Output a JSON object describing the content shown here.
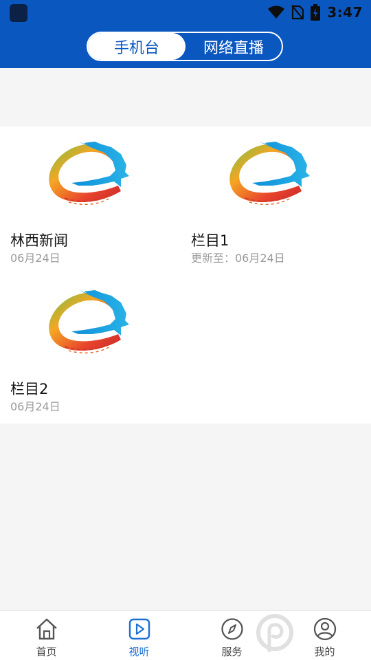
{
  "status_bar": {
    "time": "3:47",
    "icons": [
      "app-icon",
      "wifi-icon",
      "no-sim-icon",
      "battery-charging-icon"
    ]
  },
  "header": {
    "segments": [
      {
        "label": "手机台",
        "active": true
      },
      {
        "label": "网络直播",
        "active": false
      }
    ]
  },
  "cards": [
    {
      "title": "林西新闻",
      "date": "06月24日",
      "icon": "station-logo-icon"
    },
    {
      "title": "栏目1",
      "date": "更新至：06月24日",
      "icon": "station-logo-icon"
    },
    {
      "title": "栏目2",
      "date": "06月24日",
      "icon": "station-logo-icon"
    }
  ],
  "tabbar": {
    "items": [
      {
        "label": "首页",
        "icon": "home-icon",
        "active": false
      },
      {
        "label": "视听",
        "icon": "play-icon",
        "active": true
      },
      {
        "label": "服务",
        "icon": "compass-icon",
        "active": false
      },
      {
        "label": "我的",
        "icon": "user-icon",
        "active": false
      }
    ]
  },
  "colors": {
    "header_blue": "#0a57c0",
    "active_tab": "#1a6fd6",
    "background": "#f5f5f5"
  }
}
